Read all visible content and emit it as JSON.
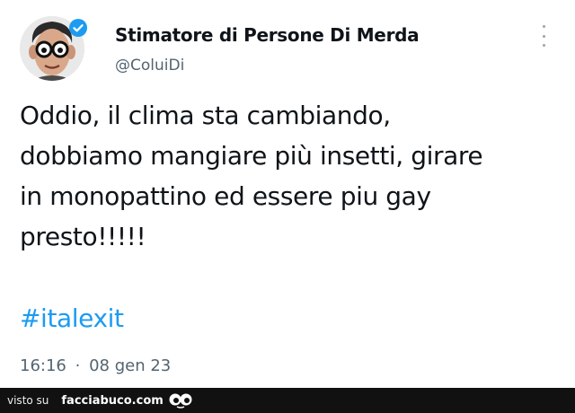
{
  "tweet": {
    "display_name": "Stimatore di Persone Di Merda",
    "handle": "@ColuiDi",
    "text": "Oddio, il clima sta cambiando,\ndobbiamo mangiare più insetti, girare\nin monopattino ed essere piu gay\npresto!!!!!",
    "hashtag": "#italexit",
    "time": "16:16",
    "separator": "·",
    "date": "08 gen 23"
  },
  "footer": {
    "seen_on": "visto su",
    "site": "facciabuco.com"
  },
  "icons": {
    "verified": "verified-badge-icon",
    "more": "more-options-icon",
    "logo": "eyes-logo-icon"
  },
  "colors": {
    "text": "#0f1419",
    "secondary": "#536471",
    "link": "#1d9bf0",
    "footer_bg": "#111111"
  }
}
